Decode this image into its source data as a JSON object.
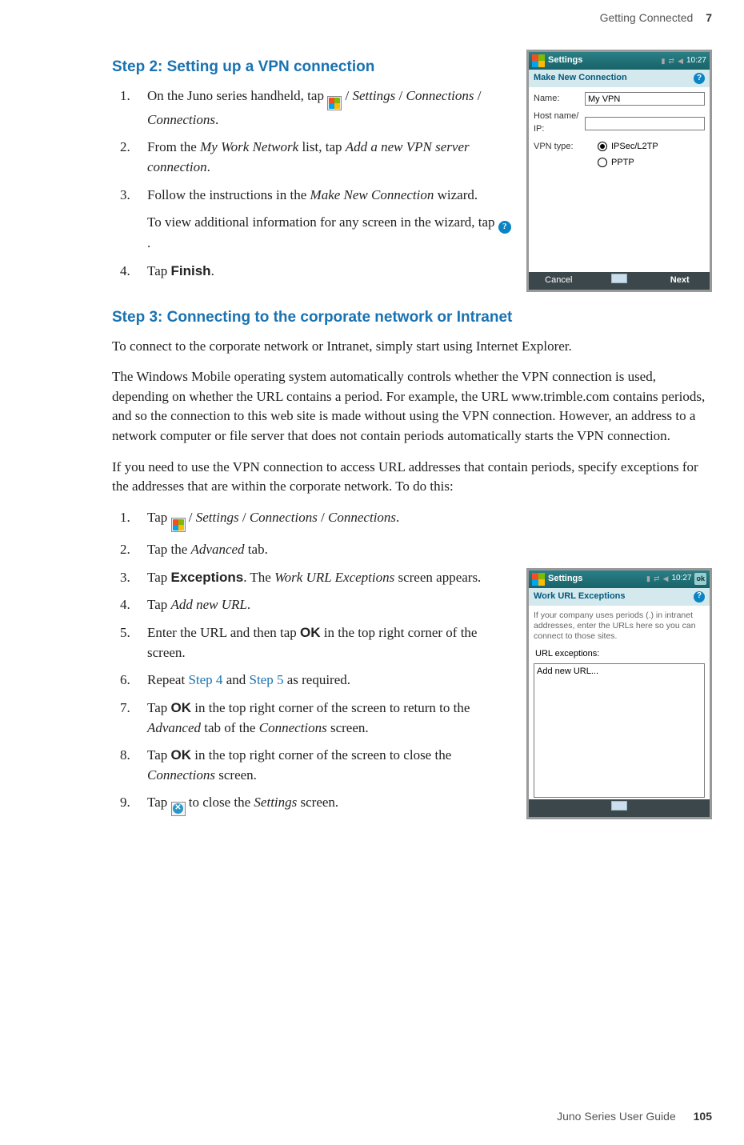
{
  "header": {
    "section": "Getting Connected",
    "chapter": "7"
  },
  "footer": {
    "book": "Juno Series User Guide",
    "page": "105"
  },
  "step2": {
    "title": "Step 2: Setting up a VPN connection",
    "items": [
      {
        "n": "1.",
        "pre": "On the Juno series handheld, tap ",
        "post": " / ",
        "i1": "Settings",
        "sep1": " / ",
        "i2": "Connections",
        "sep2": " / ",
        "i3": "Connections",
        "end": "."
      },
      {
        "n": "2.",
        "pre": "From the ",
        "i1": "My Work Network",
        "mid": " list, tap ",
        "i2": "Add a new VPN server connection",
        "end": "."
      },
      {
        "n": "3.",
        "pre": "Follow the instructions in the ",
        "i1": "Make New Connection",
        "post": " wizard.",
        "sub": {
          "pre": "To view additional information for any screen in the wizard, tap ",
          "end": "."
        }
      },
      {
        "n": "4.",
        "pre": "Tap ",
        "b": "Finish",
        "end": "."
      }
    ]
  },
  "shot1": {
    "title": "Settings",
    "time": "10:27",
    "subtitle": "Make New Connection",
    "name_label": "Name:",
    "name_value": "My VPN",
    "host_label": "Host name/ IP:",
    "host_value": "",
    "type_label": "VPN type:",
    "opt1": "IPSec/L2TP",
    "opt2": "PPTP",
    "cancel": "Cancel",
    "next": "Next"
  },
  "step3": {
    "title": "Step 3: Connecting to the corporate network or Intranet",
    "p1": "To connect to the corporate network or Intranet, simply start using Internet Explorer.",
    "p2": "The Windows Mobile operating system automatically controls whether the VPN connection is used, depending on whether the URL contains a period. For example, the URL www.trimble.com contains periods, and so the connection to this web site is made without using the VPN connection. However, an address to a network computer or file server that does not contain periods automatically starts the VPN connection.",
    "p3": "If you need to use the VPN connection to access URL addresses that contain periods, specify exceptions for the addresses that are within the corporate network. To do this:",
    "items": [
      {
        "n": "1.",
        "pre": "Tap ",
        "post": " / ",
        "i1": "Settings",
        "s1": " / ",
        "i2": "Connections",
        "s2": " / ",
        "i3": "Connections",
        "end": "."
      },
      {
        "n": "2.",
        "pre": "Tap the ",
        "i1": "Advanced",
        "post": " tab."
      },
      {
        "n": "3.",
        "pre": "Tap ",
        "b": "Exceptions",
        "mid": ". The ",
        "i1": "Work URL Exceptions",
        "post": " screen appears."
      },
      {
        "n": "4.",
        "pre": "Tap ",
        "i1": "Add new URL",
        "end": "."
      },
      {
        "n": "5.",
        "pre": "Enter the URL and then tap ",
        "b": "OK",
        "post": " in the top right corner of the screen."
      },
      {
        "n": "6.",
        "pre": "Repeat ",
        "l1": "Step 4",
        "mid": " and ",
        "l2": "Step 5",
        "post": " as required."
      },
      {
        "n": "7.",
        "pre": "Tap ",
        "b": "OK",
        "mid": " in the top right corner of the screen to return to the ",
        "i1": "Advanced",
        "mid2": " tab of the ",
        "i2": "Connections",
        "post": " screen."
      },
      {
        "n": "8.",
        "pre": "Tap ",
        "b": "OK",
        "mid": " in the top right corner of the screen to close the ",
        "i1": "Connections",
        "post": " screen."
      },
      {
        "n": "9.",
        "pre": "Tap ",
        "post": " to close the ",
        "i1": "Settings",
        "end": " screen."
      }
    ]
  },
  "shot2": {
    "title": "Settings",
    "time": "10:27",
    "ok": "ok",
    "subtitle": "Work URL Exceptions",
    "info": "If your company uses periods (.) in intranet addresses, enter the URLs here so you can connect to those sites.",
    "list_label": "URL exceptions:",
    "row": "Add new URL..."
  }
}
